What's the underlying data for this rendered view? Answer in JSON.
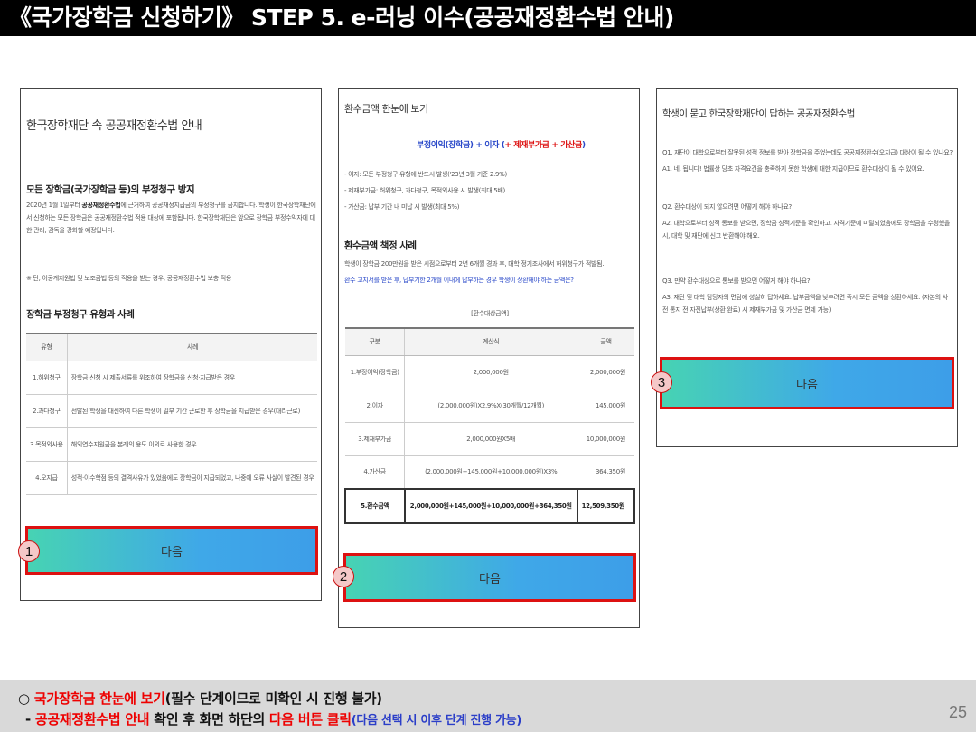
{
  "header": {
    "title": "《국가장학금 신청하기》 STEP 5. e-러닝 이수(공공재정환수법 안내)"
  },
  "panel1": {
    "heading": "한국장학재단 속 공공재정환수법 안내",
    "section1_title": "모든 장학금(국가장학금 등)의 부정청구 방지",
    "section1_text_pre": "2020년 1월 1일부터 ",
    "section1_text_bold": "공공재정환수법",
    "section1_text_post": "에 근거하여 공공재정지급금의 부정청구를 금지합니다. 학생이 한국장학재단에서 신청하는 모든 장학금은 공공재정환수법 적용 대상에 포함됩니다. 한국장학재단은 앞으로 장학금 부정수익자에 대한 관리, 감독을 강화할 예정입니다.",
    "note": "※ 단, 이공계지원법 및 보조금법 등의 적용을 받는 경우, 공공재정환수법 보충 적용",
    "section2_title": "장학금 부정청구 유형과 사례",
    "table_headers": [
      "유형",
      "사례"
    ],
    "table_rows": [
      [
        "1.허위청구",
        "장학금 신청 시 제출서류를 위조하여 장학금을 신청·지급받은 경우"
      ],
      [
        "2.과다청구",
        "선발된 학생을 대신하여 다른 학생이 일부 기간 근로한 후 장학금을 지급받은 경우(대리근로)"
      ],
      [
        "3.목적외사용",
        "해외연수지원금을 본래의 용도 이외로 사용한 경우"
      ],
      [
        "4.오지급",
        "성적·이수학점 등의 결격사유가 있었음에도 장학금이 지급되었고, 나중에 오류 사실이 발견된 경우"
      ]
    ],
    "next_label": "다음",
    "step": "1"
  },
  "panel2": {
    "heading": "환수금액 한눈에 보기",
    "formula_blue": "부정이익(장학금) + 이자 (",
    "formula_red": "+ 제재부가금 + 가산금",
    "formula_blue_end": ")",
    "bullets": [
      "- 이자: 모든 부정청구 유형에 반드시 발생('23년 3월 기준 2.9%)",
      "- 제재부가금: 허위청구, 과다청구, 목적외사용 시 발생(최대 5배)",
      "- 가산금: 납부 기간 내 미납 시 발생(최대 5%)"
    ],
    "section_title": "환수금액 책정 사례",
    "case_text": "학생이 장학금 200만원을 받은 시점으로부터 2년 6개월 경과 후, 대학 정기조사에서 허위청구가 적발됨.",
    "case_blue": "환수 고지서를 받은 후, 납부기한 2개월 이내에 납부하는 경우 학생이 상환해야 하는 금액은?",
    "table_caption": "[환수대상금액]",
    "table_headers": [
      "구분",
      "계산식",
      "금액"
    ],
    "table_rows": [
      [
        "1.부정이익(장학금)",
        "2,000,000원",
        "2,000,000원"
      ],
      [
        "2.이자",
        "(2,000,000원)X2.9%X(30개월/12개월)",
        "145,000원"
      ],
      [
        "3.제재부가금",
        "2,000,000원X5배",
        "10,000,000원"
      ],
      [
        "4.가산금",
        "(2,000,000원+145,000원+10,000,000원)X3%",
        "364,350원"
      ]
    ],
    "total_row": [
      "5.환수금액",
      "2,000,000원+145,000원+10,000,000원+364,350원",
      "12,509,350원"
    ],
    "next_label": "다음",
    "step": "2"
  },
  "panel3": {
    "heading": "학생이 묻고 한국장학재단이 답하는 공공재정환수법",
    "qa": [
      "Q1. 재단이 대학으로부터 잘못된 성적 정보를 받아 장학금을 주었는데도 공공재정환수(오지급) 대상이 될 수 있나요?",
      "A1. 네, 됩니다! 법률상 당초 자격요건을 충족하지 못한 학생에 대한 지급이므로 환수대상이 될 수 있어요.",
      "Q2. 환수대상이 되지 않으려면 어떻게 해야 하나요?",
      "A2. 대학으로부터 성적 통보를 받으면, 장학금 성적기준을 확인하고, 자격기준에 미달되었음에도 장학금을 수령했을 시, 대학 및 재단에 신고 반환해야 해요.",
      "Q3. 만약 환수대상으로 통보를 받으면 어떻게 해야 하나요?",
      "A3. 재단 및 대학 담당자의 면담에 성실히 답하세요. 납부금액을 낮추려면 즉시 모든 금액을 상환하세요. (자본의 사전 통지 전 자진납부(상환 완료) 시 제재부가금 및 가산금 면제 가능)"
    ],
    "next_label": "다음",
    "step": "3"
  },
  "footer": {
    "line1_bullet": "○ ",
    "line1_red": "국가장학금 한눈에 보기",
    "line1_rest": "(필수 단계이므로 미확인 시 진행 불가)",
    "line2_prefix": " - ",
    "line2_red1": "공공재정환수법 안내",
    "line2_mid": " 확인 후 화면 하단의 ",
    "line2_red2": "다음 버튼 클릭",
    "line2_blue": "(다음 선택 시 이후 단계 진행 가능)"
  },
  "page_number": "25"
}
